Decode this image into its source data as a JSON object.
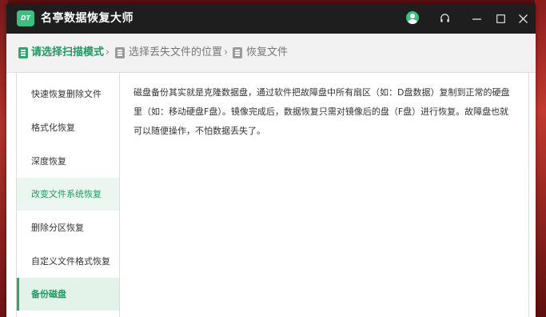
{
  "window": {
    "title": "名亭数据恢复大师",
    "logo_text": "DT",
    "accent_color": "#2da66e",
    "titlebar_color": "#1e1e1e",
    "icons": [
      "avatar-icon",
      "headset-icon",
      "minimize-icon",
      "maximize-icon",
      "close-icon"
    ]
  },
  "breadcrumb": {
    "steps": [
      {
        "label": "请选择扫描模式",
        "state": "active"
      },
      {
        "label": "选择丢失文件的位置",
        "state": "inactive"
      },
      {
        "label": "恢复文件",
        "state": "inactive"
      }
    ],
    "separator": "›"
  },
  "sidebar": {
    "items": [
      {
        "label": "快速恢复删除文件",
        "state": "normal"
      },
      {
        "label": "格式化恢复",
        "state": "normal"
      },
      {
        "label": "深度恢复",
        "state": "normal"
      },
      {
        "label": "改变文件系统恢复",
        "state": "hover"
      },
      {
        "label": "删除分区恢复",
        "state": "normal"
      },
      {
        "label": "自定义文件格式恢复",
        "state": "normal"
      },
      {
        "label": "备份磁盘",
        "state": "selected"
      }
    ]
  },
  "main": {
    "description": "磁盘备份其实就是克隆数据盘，通过软件把故障盘中所有扇区（如：D盘数据）复制到正常的硬盘里（如：移动硬盘F盘）。镜像完成后，数据恢复只需对镜像后的盘（F盘）进行恢复。故障盘也就可以随便操作，不怕数据丢失了。"
  }
}
